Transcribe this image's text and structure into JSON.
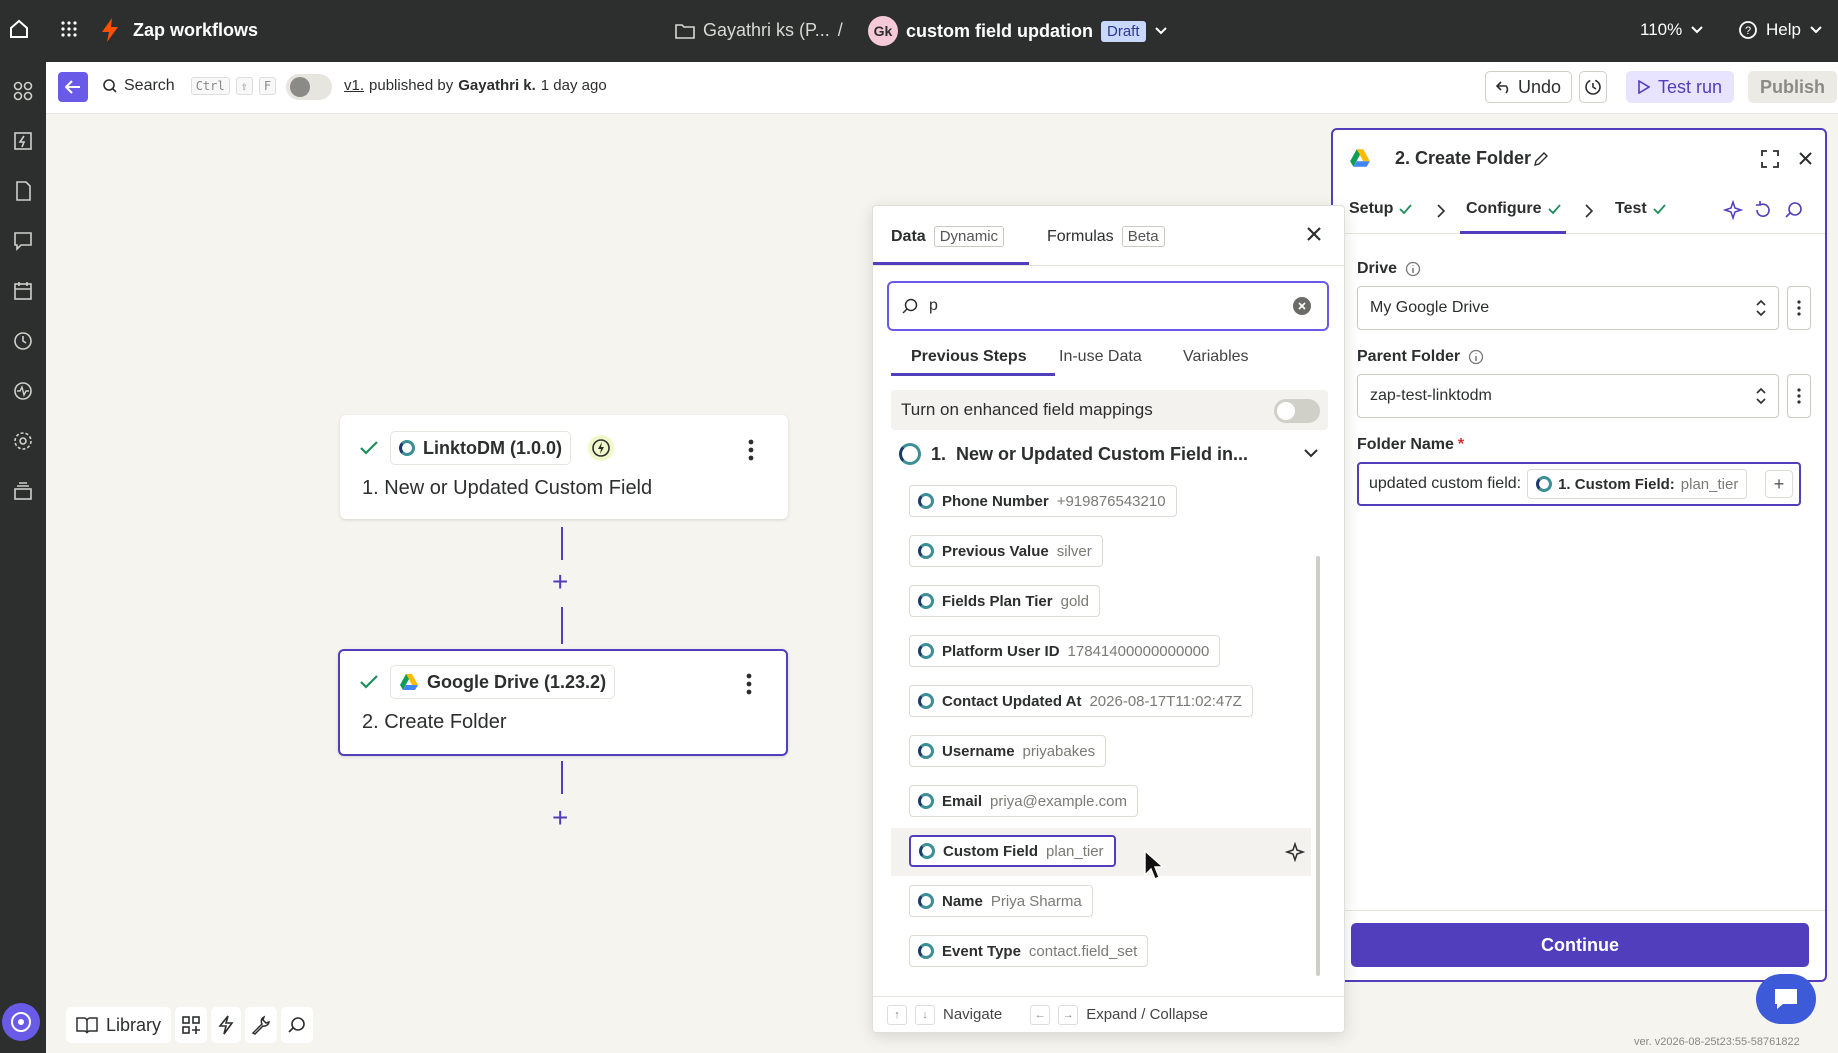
{
  "topbar": {
    "app_title": "Zap workflows",
    "folder": "Gayathri ks (P...",
    "separator": "/",
    "avatar_initials": "Gk",
    "zap_name": "custom field updation",
    "status_badge": "Draft",
    "zoom": "110%",
    "help": "Help"
  },
  "toolbar": {
    "search_label": "Search",
    "shortcut": [
      "Ctrl",
      "⇧",
      "F"
    ],
    "version_link": "v1.",
    "published_by": "published by",
    "publisher": "Gayathri k.",
    "published_time": "1 day ago",
    "undo": "Undo",
    "test_run": "Test run",
    "publish": "Publish"
  },
  "steps": [
    {
      "app": "LinktoDM (1.0.0)",
      "title": "1. New or Updated Custom Field"
    },
    {
      "app": "Google Drive (1.23.2)",
      "title": "2. Create Folder"
    }
  ],
  "picker": {
    "tab_data": "Data",
    "tab_data_badge": "Dynamic",
    "tab_formulas": "Formulas",
    "tab_formulas_badge": "Beta",
    "search_value": "p",
    "subtabs": [
      "Previous Steps",
      "In-use Data",
      "Variables"
    ],
    "toggle_label": "Turn on enhanced field mappings",
    "group_number": "1.",
    "group_title": "New or Updated Custom Field in...",
    "fields": [
      {
        "label": "Phone Number",
        "value": "+919876543210"
      },
      {
        "label": "Previous Value",
        "value": "silver"
      },
      {
        "label": "Fields Plan Tier",
        "value": "gold"
      },
      {
        "label": "Platform User ID",
        "value": "17841400000000000"
      },
      {
        "label": "Contact Updated At",
        "value": "2026-08-17T11:02:47Z"
      },
      {
        "label": "Username",
        "value": "priyabakes"
      },
      {
        "label": "Email",
        "value": "priya@example.com"
      },
      {
        "label": "Custom Field",
        "value": "plan_tier"
      },
      {
        "label": "Name",
        "value": "Priya Sharma"
      },
      {
        "label": "Event Type",
        "value": "contact.field_set"
      }
    ],
    "footer_navigate": "Navigate",
    "footer_expand": "Expand / Collapse"
  },
  "panel": {
    "title": "2. Create Folder",
    "tabs": [
      "Setup",
      "Configure",
      "Test"
    ],
    "drive_label": "Drive",
    "drive_value": "My Google Drive",
    "parent_label": "Parent Folder",
    "parent_value": "zap-test-linktodm",
    "folder_name_label": "Folder Name",
    "required_mark": "*",
    "folder_name_prefix": "updated custom field:",
    "token_label": "1. Custom Field:",
    "token_value": "plan_tier",
    "continue": "Continue"
  },
  "bottom": {
    "library": "Library"
  },
  "version_text": "ver. v2026-08-25t23:55-58761822",
  "colors": {
    "brand": "#503ebd",
    "dark": "#2d2e2e",
    "canvas": "#f5f4ee",
    "zap_orange": "#ff4f00"
  }
}
